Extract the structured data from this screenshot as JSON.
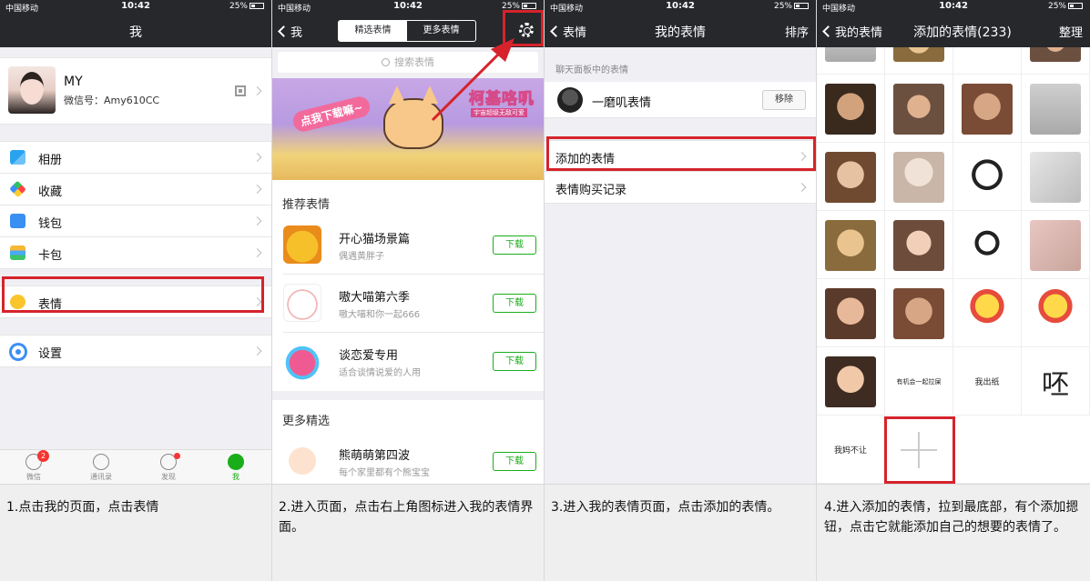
{
  "status": {
    "carrier": "中国移动",
    "time": "10:42",
    "battery": "25%"
  },
  "panel1": {
    "title": "我",
    "profile": {
      "name": "MY",
      "wechat_id": "微信号：Amy610CC"
    },
    "menu": [
      "相册",
      "收藏",
      "钱包",
      "卡包"
    ],
    "emoji_item": "表情",
    "settings_item": "设置",
    "tabs": [
      {
        "label": "微信",
        "badge": "2"
      },
      {
        "label": "通讯录"
      },
      {
        "label": "发现"
      },
      {
        "label": "我"
      }
    ]
  },
  "panel2": {
    "back": "我",
    "segments": [
      "精选表情",
      "更多表情"
    ],
    "search_placeholder": "搜索表情",
    "banner": {
      "title": "柯基咯叽",
      "subtitle": "宇宙超级无敌可爱",
      "button": "点我下载嘛~"
    },
    "recommended_header": "推荐表情",
    "packs": [
      {
        "name": "开心猫场景篇",
        "desc": "偶遇黄胖子",
        "button": "下载"
      },
      {
        "name": "嗷大喵第六季",
        "desc": "嗷大喵和你一起666",
        "button": "下载"
      },
      {
        "name": "谈恋爱专用",
        "desc": "适合谈情说爱的人用",
        "button": "下载"
      }
    ],
    "more_header": "更多精选",
    "more_packs": [
      {
        "name": "熊萌萌第四波",
        "desc": "每个家里都有个熊宝宝",
        "button": "下载"
      }
    ]
  },
  "panel3": {
    "back": "表情",
    "title": "我的表情",
    "right": "排序",
    "section_caption": "聊天面板中的表情",
    "owned": {
      "name": "一磨叽表情",
      "button": "移除"
    },
    "rows": [
      "添加的表情",
      "表情购买记录"
    ]
  },
  "panel4": {
    "back": "我的表情",
    "title": "添加的表情(233)",
    "right": "整理",
    "text_cells": {
      "r5c2": "有机会一起拉屎",
      "r5c3": "我出纸",
      "r5c4": "呸",
      "r6c1": "我妈不让"
    }
  },
  "captions": [
    "1.点击我的页面，点击表情",
    "2.进入页面，点击右上角图标进入我的表情界面。",
    "3.进入我的表情页面，点击添加的表情。",
    "4.进入添加的表情，拉到最底部，有个添加摁钮，点击它就能添加自己的想要的表情了。"
  ],
  "colors": {
    "navbar": "#26282c",
    "accent_green": "#1aad19",
    "highlight_red": "#d6232b",
    "badge_red": "#f43530"
  }
}
